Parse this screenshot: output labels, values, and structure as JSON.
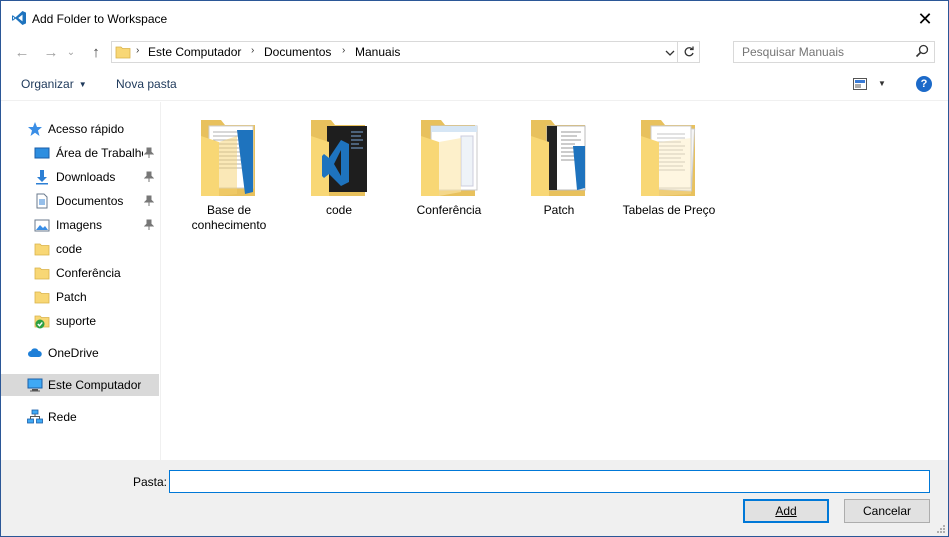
{
  "window": {
    "title": "Add Folder to Workspace",
    "close_glyph": "✕"
  },
  "nav": {
    "back_glyph": "←",
    "forward_glyph": "→",
    "recent_glyph": "⌄",
    "up_glyph": "↑",
    "breadcrumb": [
      "Este Computador",
      "Documentos",
      "Manuais"
    ],
    "separator": "›",
    "search_placeholder": "Pesquisar Manuais"
  },
  "toolbar": {
    "organize_label": "Organizar",
    "new_folder_label": "Nova pasta",
    "help_label": "?"
  },
  "sidebar": {
    "items": [
      {
        "label": "Acesso rápido",
        "icon": "star-icon",
        "pinned": false
      },
      {
        "label": "Área de Trabalho",
        "icon": "desktop-icon",
        "pinned": true
      },
      {
        "label": "Downloads",
        "icon": "download-icon",
        "pinned": true
      },
      {
        "label": "Documentos",
        "icon": "document-icon",
        "pinned": true
      },
      {
        "label": "Imagens",
        "icon": "pictures-icon",
        "pinned": true
      },
      {
        "label": "code",
        "icon": "folder-icon",
        "pinned": false
      },
      {
        "label": "Conferência",
        "icon": "folder-icon",
        "pinned": false
      },
      {
        "label": "Patch",
        "icon": "folder-icon",
        "pinned": false
      },
      {
        "label": "suporte",
        "icon": "folder-synced-icon",
        "pinned": false
      },
      {
        "label": "OneDrive",
        "icon": "cloud-icon",
        "pinned": false
      },
      {
        "label": "Este Computador",
        "icon": "computer-icon",
        "pinned": false,
        "selected": true
      },
      {
        "label": "Rede",
        "icon": "network-icon",
        "pinned": false
      }
    ],
    "pin_glyph": "📌"
  },
  "folders": [
    {
      "name": "Base de conhecimento",
      "thumb": "documents"
    },
    {
      "name": "code",
      "thumb": "vscode"
    },
    {
      "name": "Conferência",
      "thumb": "window"
    },
    {
      "name": "Patch",
      "thumb": "dark-doc"
    },
    {
      "name": "Tabelas de Preço",
      "thumb": "paper"
    }
  ],
  "footer": {
    "folder_label": "Pasta:",
    "folder_value": "",
    "add_label": "Add",
    "cancel_label": "Cancelar"
  },
  "colors": {
    "accent": "#0078d7",
    "folder": "#f8d775",
    "vscode": "#1e73be"
  }
}
